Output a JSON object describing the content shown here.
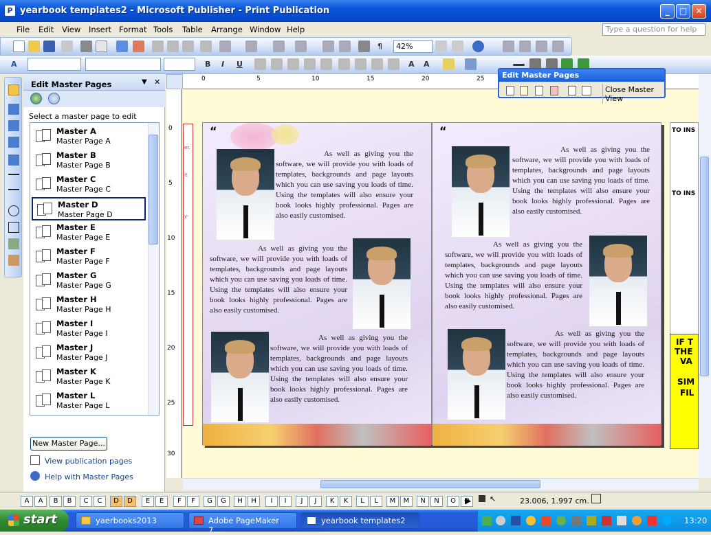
{
  "window": {
    "title": "yearbook templates2 - Microsoft Publisher - Print Publication"
  },
  "menu": [
    "File",
    "Edit",
    "View",
    "Insert",
    "Format",
    "Tools",
    "Table",
    "Arrange",
    "Window",
    "Help"
  ],
  "help_placeholder": "Type a question for help",
  "toolbar": {
    "zoom": "42%"
  },
  "task_pane": {
    "title": "Edit Master Pages",
    "select_label": "Select a master page to edit",
    "masters": [
      {
        "name": "Master A",
        "sub": "Master Page A"
      },
      {
        "name": "Master B",
        "sub": "Master Page B"
      },
      {
        "name": "Master C",
        "sub": "Master Page C"
      },
      {
        "name": "Master D",
        "sub": "Master Page D"
      },
      {
        "name": "Master E",
        "sub": "Master Page E"
      },
      {
        "name": "Master F",
        "sub": "Master Page F"
      },
      {
        "name": "Master G",
        "sub": "Master Page G"
      },
      {
        "name": "Master H",
        "sub": "Master Page H"
      },
      {
        "name": "Master I",
        "sub": "Master Page I"
      },
      {
        "name": "Master J",
        "sub": "Master Page J"
      },
      {
        "name": "Master K",
        "sub": "Master Page K"
      },
      {
        "name": "Master L",
        "sub": "Master Page L"
      }
    ],
    "selected": "Master D",
    "new_button": "New Master Page...",
    "link_view": "View publication pages",
    "link_help": "Help with Master Pages"
  },
  "floating": {
    "title": "Edit Master Pages",
    "close_label": "Close Master View"
  },
  "ruler_top": [
    "0",
    "5",
    "10",
    "15",
    "20",
    "25"
  ],
  "ruler_left": [
    "0",
    "5",
    "10",
    "15",
    "20",
    "25",
    "30"
  ],
  "body_text": "As well as giving you the software, we will provide you with loads of templates, backgrounds and page layouts which you can use saving you loads of time. Using the templates will also ensure your book looks highly professional. Pages are also easily customised.",
  "right_doc": {
    "h1": "TO INS",
    "h2": "TO INS",
    "y1": "IF T",
    "y2": "THE",
    "y3": "VA",
    "y4": "SIM",
    "y5": "FIL"
  },
  "page_tabs": [
    "A",
    "A",
    "B",
    "B",
    "C",
    "C",
    "D",
    "D",
    "E",
    "E",
    "F",
    "F",
    "G",
    "G",
    "H",
    "H",
    "I",
    "I",
    "J",
    "J",
    "K",
    "K",
    "L",
    "L",
    "M",
    "M",
    "N",
    "N",
    "O",
    "O"
  ],
  "status": {
    "coords": "23.006, 1.997 cm."
  },
  "taskbar": {
    "start": "start",
    "tasks": [
      "yaerbooks2013",
      "Adobe PageMaker 7....",
      "yearbook templates2 ..."
    ],
    "clock": "13:20"
  }
}
